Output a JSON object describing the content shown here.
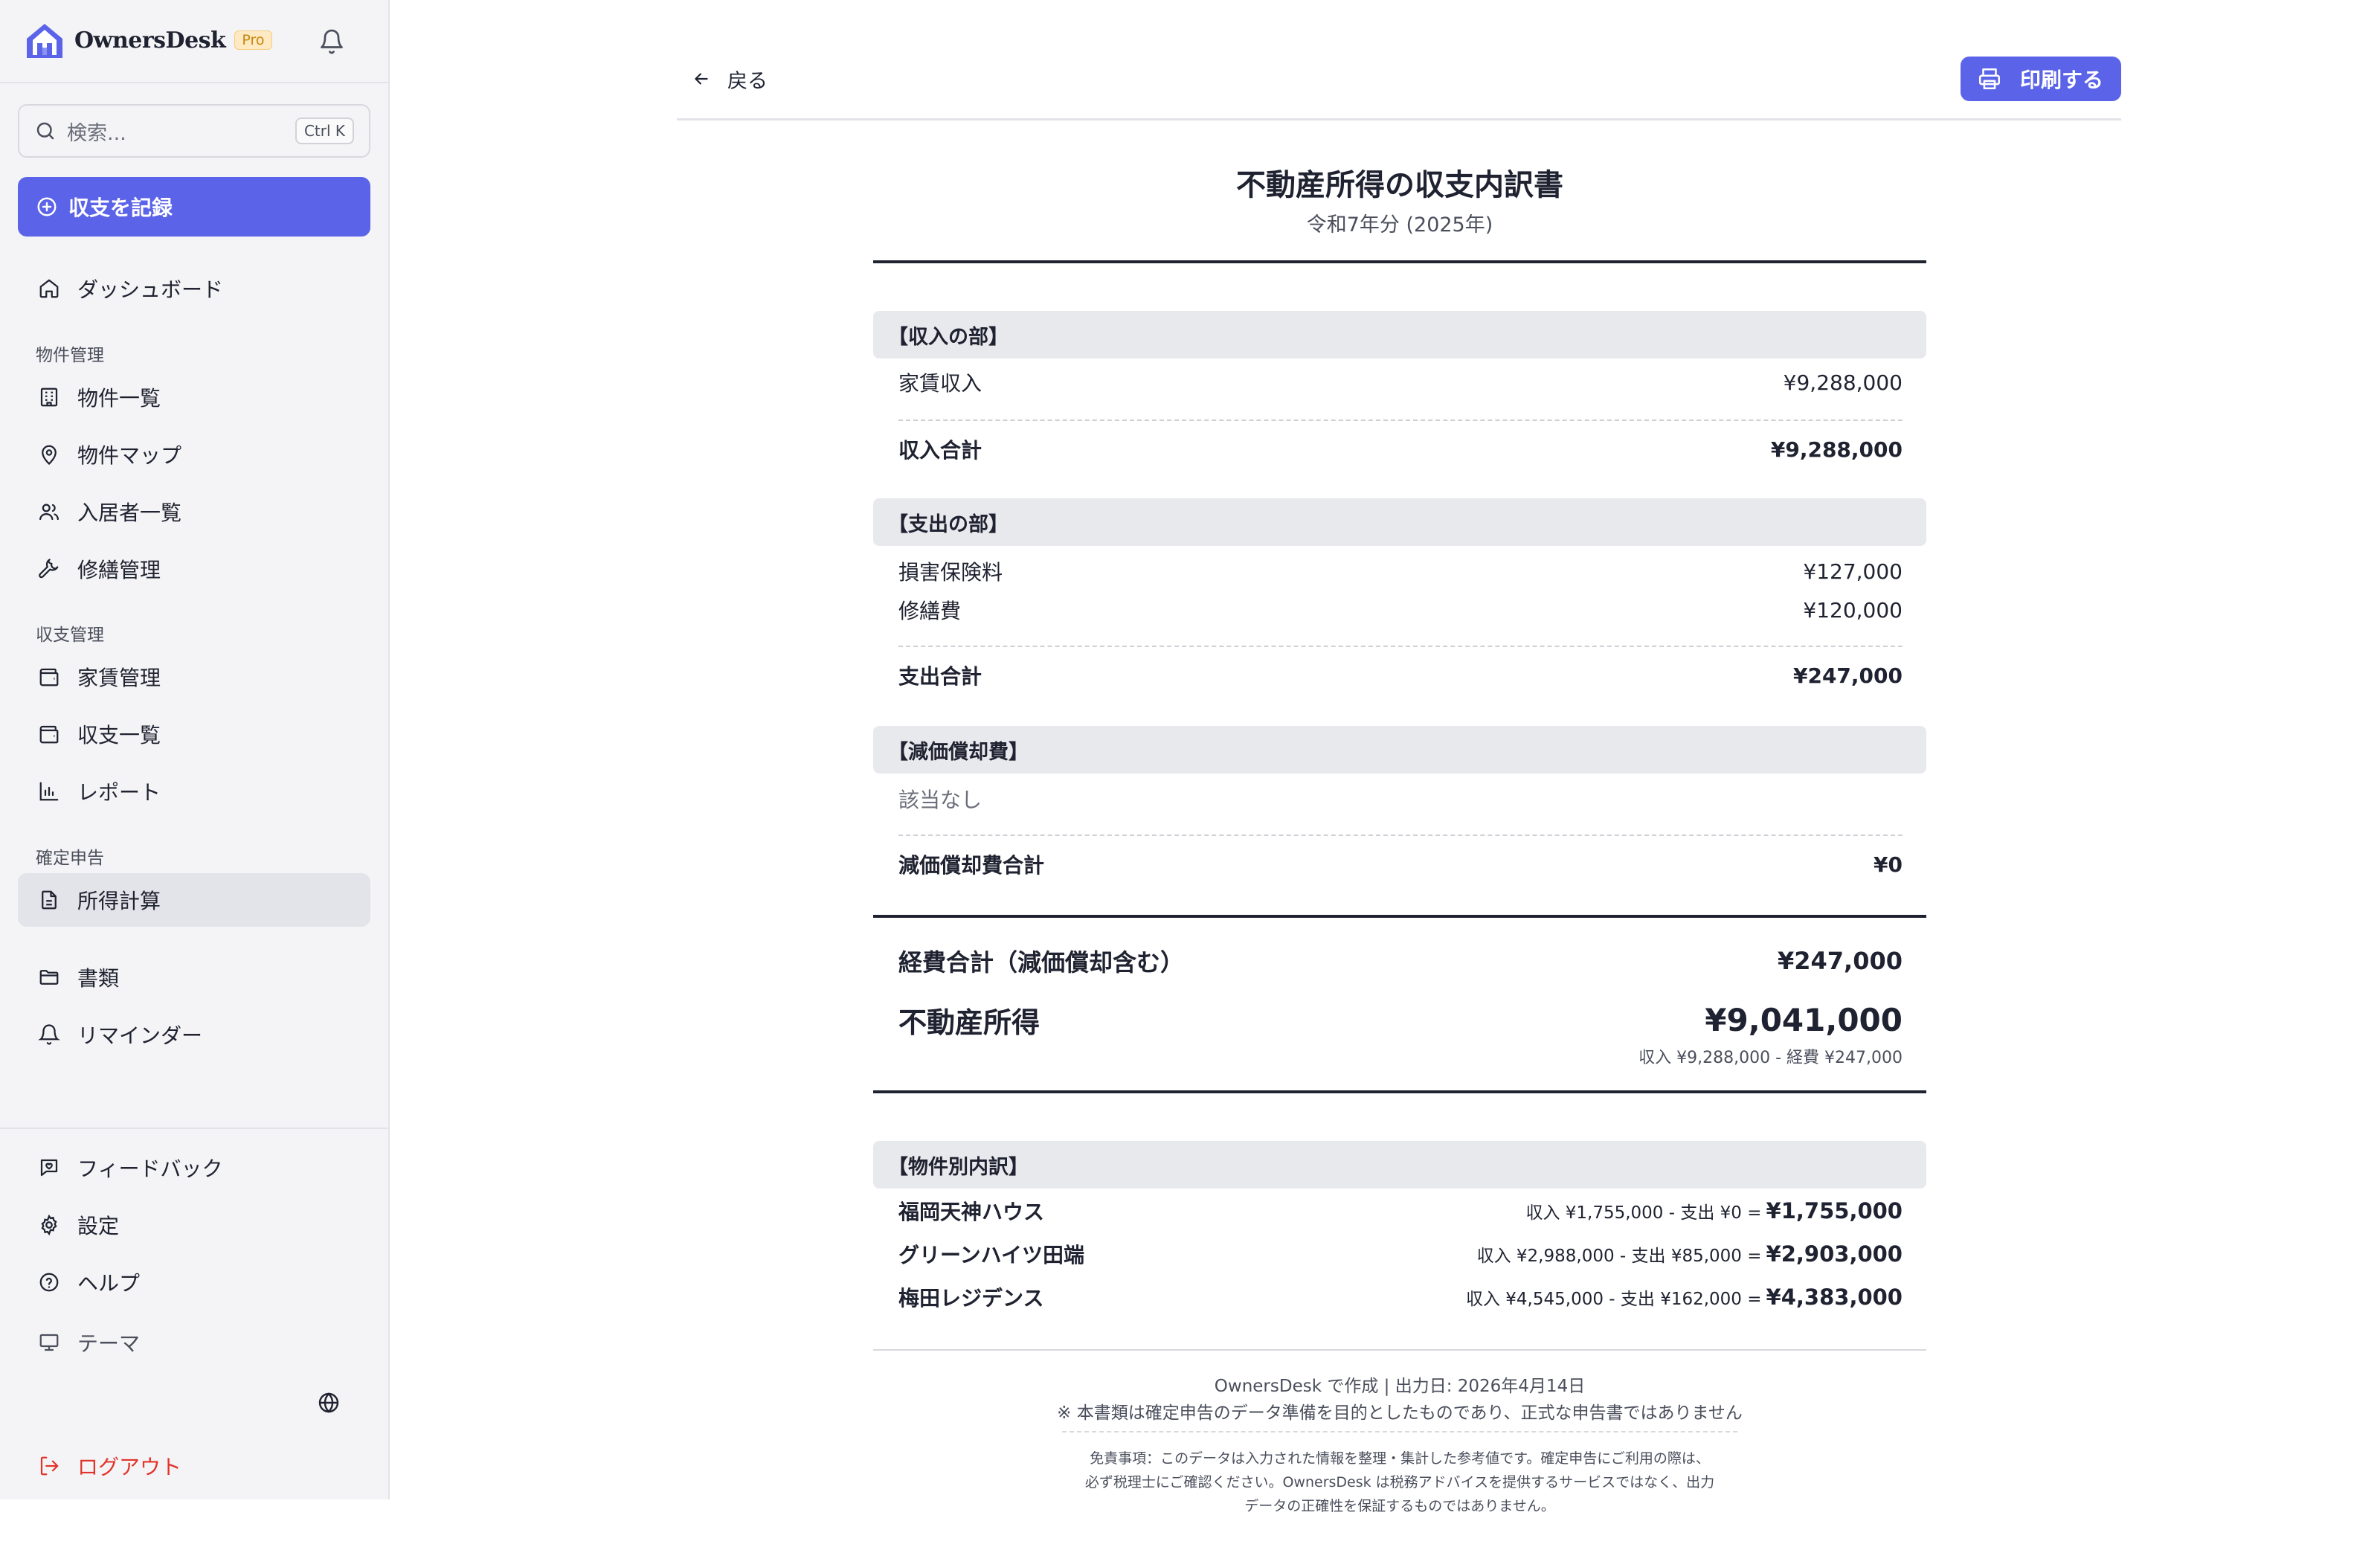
{
  "app": {
    "brand": "OwnersDesk",
    "badge": "Pro",
    "accent": "#5b63e8"
  },
  "search": {
    "placeholder": "検索...",
    "shortcut": "Ctrl K"
  },
  "record_button": "収支を記録",
  "nav": {
    "dashboard": "ダッシュボード",
    "section_property": "物件管理",
    "properties": "物件一覧",
    "property_map": "物件マップ",
    "tenants": "入居者一覧",
    "repairs": "修繕管理",
    "section_finance": "収支管理",
    "rent": "家賃管理",
    "transactions": "収支一覧",
    "reports": "レポート",
    "section_tax": "確定申告",
    "income_calc": "所得計算",
    "documents": "書類",
    "reminders": "リマインダー",
    "feedback": "フィードバック",
    "settings": "設定",
    "help": "ヘルプ",
    "theme": "テーマ",
    "logout": "ログアウト"
  },
  "toolbar": {
    "back": "戻る",
    "print": "印刷する"
  },
  "statement": {
    "title": "不動産所得の収支内訳書",
    "subtitle": "令和7年分 (2025年)",
    "income": {
      "header": "【収入の部】",
      "rows": [
        {
          "label": "家賃収入",
          "value": "¥9,288,000"
        }
      ],
      "total_label": "収入合計",
      "total_value": "¥9,288,000"
    },
    "expense": {
      "header": "【支出の部】",
      "rows": [
        {
          "label": "損害保険料",
          "value": "¥127,000"
        },
        {
          "label": "修繕費",
          "value": "¥120,000"
        }
      ],
      "total_label": "支出合計",
      "total_value": "¥247,000"
    },
    "depreciation": {
      "header": "【減価償却費】",
      "empty": "該当なし",
      "total_label": "減価償却費合計",
      "total_value": "¥0"
    },
    "summary": {
      "expense_label": "経費合計（減価償却含む）",
      "expense_value": "¥247,000",
      "income_label": "不動産所得",
      "income_value": "¥9,041,000",
      "calc_note": "収入 ¥9,288,000 - 経費 ¥247,000"
    },
    "by_property": {
      "header": "【物件別内訳】",
      "rows": [
        {
          "name": "福岡天神ハウス",
          "formula": "収入 ¥1,755,000 - 支出 ¥0 =",
          "result": "¥1,755,000"
        },
        {
          "name": "グリーンハイツ田端",
          "formula": "収入 ¥2,988,000 - 支出 ¥85,000 =",
          "result": "¥2,903,000"
        },
        {
          "name": "梅田レジデンス",
          "formula": "収入 ¥4,545,000 - 支出 ¥162,000 =",
          "result": "¥4,383,000"
        }
      ]
    },
    "footer": {
      "created": "OwnersDesk で作成 | 出力日: 2026年4月14日",
      "notice": "※ 本書類は確定申告のデータ準備を目的としたものであり、正式な申告書ではありません",
      "disclaimer_1": "免責事項：このデータは入力された情報を整理・集計した参考値です。確定申告にご利用の際は、",
      "disclaimer_2": "必ず税理士にご確認ください。OwnersDesk は税務アドバイスを提供するサービスではなく、出力",
      "disclaimer_3": "データの正確性を保証するものではありません。"
    }
  }
}
